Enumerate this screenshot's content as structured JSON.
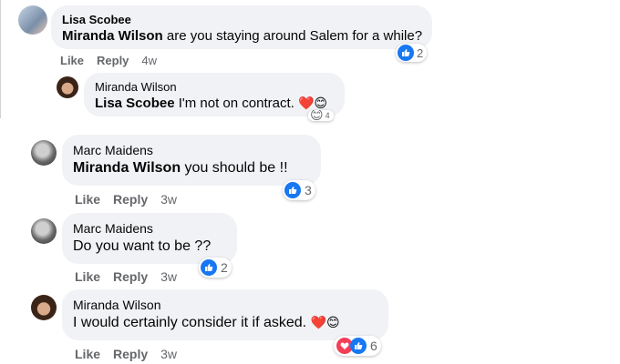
{
  "comments": [
    {
      "author": "Lisa Scobee",
      "mention": "Miranda Wilson",
      "text": " are you staying around Salem for a while?",
      "like": "Like",
      "reply": "Reply",
      "time": "4w",
      "reaction_count": "2"
    },
    {
      "author": "Miranda Wilson",
      "mention": "Lisa Scobee",
      "text": " I'm not on contract. ",
      "emoji": "❤️😊",
      "reaction_count": "4"
    },
    {
      "author": "Marc Maidens",
      "mention": "Miranda Wilson",
      "text": " you should be !!",
      "like": "Like",
      "reply": "Reply",
      "time": "3w",
      "reaction_count": "3"
    },
    {
      "author": "Marc Maidens",
      "mention": "",
      "text": "Do you want to be ??",
      "like": "Like",
      "reply": "Reply",
      "time": "3w",
      "reaction_count": "2"
    },
    {
      "author": "Miranda Wilson",
      "mention": "",
      "text": "I would certainly consider it if asked. ",
      "emoji": "❤️😊",
      "like": "Like",
      "reply": "Reply",
      "time": "3w",
      "reaction_count": "6"
    }
  ],
  "colors": {
    "bubble": "#f0f2f5",
    "like_blue": "#1877f2",
    "heart_red": "#f33e58",
    "meta_gray": "#65676b"
  }
}
